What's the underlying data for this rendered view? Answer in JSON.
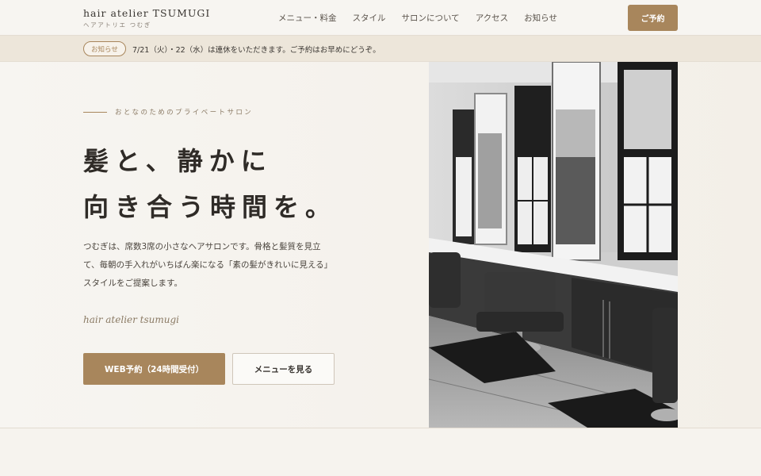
{
  "header": {
    "logo_main": "hair atelier TSUMUGI",
    "logo_sub": "ヘアアトリエ つむぎ",
    "nav": [
      "メニュー・料金",
      "スタイル",
      "サロンについて",
      "アクセス",
      "お知らせ"
    ],
    "reserve_label": "ご予約"
  },
  "notice": {
    "badge": "お知らせ",
    "text": "7/21（火）・22（水）は連休をいただきます。ご予約はお早めにどうぞ。"
  },
  "hero": {
    "eyebrow": "おとなのためのプライベートサロン",
    "headline_line1": "髪と、静かに",
    "headline_line2": "向き合う時間を。",
    "lead_lines": [
      "つむぎは、席数3席の小さなヘアサロンです。骨格と髪質を見立",
      "て、毎朝の手入れがいちばん楽になる「素の髪がきれいに見える」",
      "スタイルをご提案します。"
    ],
    "script": "hair atelier tsumugi",
    "primary_button": "WEB予約（24時間受付）",
    "secondary_button": "メニューを見る"
  },
  "colors": {
    "accent": "#a8865c",
    "background": "#f6f3ee",
    "notice_bg": "#ede6da",
    "text": "#3a3632"
  },
  "icons": []
}
